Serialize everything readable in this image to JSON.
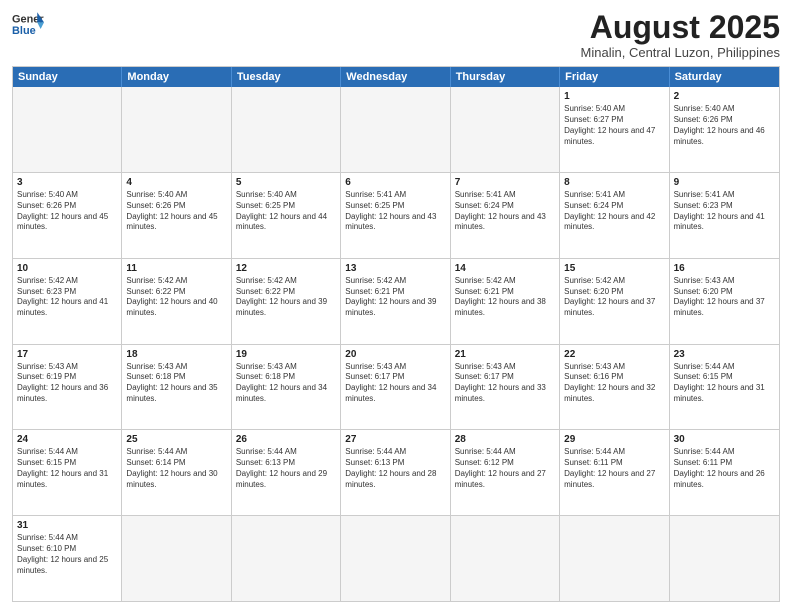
{
  "header": {
    "logo_general": "General",
    "logo_blue": "Blue",
    "month_year": "August 2025",
    "location": "Minalin, Central Luzon, Philippines"
  },
  "weekdays": [
    "Sunday",
    "Monday",
    "Tuesday",
    "Wednesday",
    "Thursday",
    "Friday",
    "Saturday"
  ],
  "rows": [
    [
      {
        "day": "",
        "info": ""
      },
      {
        "day": "",
        "info": ""
      },
      {
        "day": "",
        "info": ""
      },
      {
        "day": "",
        "info": ""
      },
      {
        "day": "",
        "info": ""
      },
      {
        "day": "1",
        "info": "Sunrise: 5:40 AM\nSunset: 6:27 PM\nDaylight: 12 hours and 47 minutes."
      },
      {
        "day": "2",
        "info": "Sunrise: 5:40 AM\nSunset: 6:26 PM\nDaylight: 12 hours and 46 minutes."
      }
    ],
    [
      {
        "day": "3",
        "info": "Sunrise: 5:40 AM\nSunset: 6:26 PM\nDaylight: 12 hours and 45 minutes."
      },
      {
        "day": "4",
        "info": "Sunrise: 5:40 AM\nSunset: 6:26 PM\nDaylight: 12 hours and 45 minutes."
      },
      {
        "day": "5",
        "info": "Sunrise: 5:40 AM\nSunset: 6:25 PM\nDaylight: 12 hours and 44 minutes."
      },
      {
        "day": "6",
        "info": "Sunrise: 5:41 AM\nSunset: 6:25 PM\nDaylight: 12 hours and 43 minutes."
      },
      {
        "day": "7",
        "info": "Sunrise: 5:41 AM\nSunset: 6:24 PM\nDaylight: 12 hours and 43 minutes."
      },
      {
        "day": "8",
        "info": "Sunrise: 5:41 AM\nSunset: 6:24 PM\nDaylight: 12 hours and 42 minutes."
      },
      {
        "day": "9",
        "info": "Sunrise: 5:41 AM\nSunset: 6:23 PM\nDaylight: 12 hours and 41 minutes."
      }
    ],
    [
      {
        "day": "10",
        "info": "Sunrise: 5:42 AM\nSunset: 6:23 PM\nDaylight: 12 hours and 41 minutes."
      },
      {
        "day": "11",
        "info": "Sunrise: 5:42 AM\nSunset: 6:22 PM\nDaylight: 12 hours and 40 minutes."
      },
      {
        "day": "12",
        "info": "Sunrise: 5:42 AM\nSunset: 6:22 PM\nDaylight: 12 hours and 39 minutes."
      },
      {
        "day": "13",
        "info": "Sunrise: 5:42 AM\nSunset: 6:21 PM\nDaylight: 12 hours and 39 minutes."
      },
      {
        "day": "14",
        "info": "Sunrise: 5:42 AM\nSunset: 6:21 PM\nDaylight: 12 hours and 38 minutes."
      },
      {
        "day": "15",
        "info": "Sunrise: 5:42 AM\nSunset: 6:20 PM\nDaylight: 12 hours and 37 minutes."
      },
      {
        "day": "16",
        "info": "Sunrise: 5:43 AM\nSunset: 6:20 PM\nDaylight: 12 hours and 37 minutes."
      }
    ],
    [
      {
        "day": "17",
        "info": "Sunrise: 5:43 AM\nSunset: 6:19 PM\nDaylight: 12 hours and 36 minutes."
      },
      {
        "day": "18",
        "info": "Sunrise: 5:43 AM\nSunset: 6:18 PM\nDaylight: 12 hours and 35 minutes."
      },
      {
        "day": "19",
        "info": "Sunrise: 5:43 AM\nSunset: 6:18 PM\nDaylight: 12 hours and 34 minutes."
      },
      {
        "day": "20",
        "info": "Sunrise: 5:43 AM\nSunset: 6:17 PM\nDaylight: 12 hours and 34 minutes."
      },
      {
        "day": "21",
        "info": "Sunrise: 5:43 AM\nSunset: 6:17 PM\nDaylight: 12 hours and 33 minutes."
      },
      {
        "day": "22",
        "info": "Sunrise: 5:43 AM\nSunset: 6:16 PM\nDaylight: 12 hours and 32 minutes."
      },
      {
        "day": "23",
        "info": "Sunrise: 5:44 AM\nSunset: 6:15 PM\nDaylight: 12 hours and 31 minutes."
      }
    ],
    [
      {
        "day": "24",
        "info": "Sunrise: 5:44 AM\nSunset: 6:15 PM\nDaylight: 12 hours and 31 minutes."
      },
      {
        "day": "25",
        "info": "Sunrise: 5:44 AM\nSunset: 6:14 PM\nDaylight: 12 hours and 30 minutes."
      },
      {
        "day": "26",
        "info": "Sunrise: 5:44 AM\nSunset: 6:13 PM\nDaylight: 12 hours and 29 minutes."
      },
      {
        "day": "27",
        "info": "Sunrise: 5:44 AM\nSunset: 6:13 PM\nDaylight: 12 hours and 28 minutes."
      },
      {
        "day": "28",
        "info": "Sunrise: 5:44 AM\nSunset: 6:12 PM\nDaylight: 12 hours and 27 minutes."
      },
      {
        "day": "29",
        "info": "Sunrise: 5:44 AM\nSunset: 6:11 PM\nDaylight: 12 hours and 27 minutes."
      },
      {
        "day": "30",
        "info": "Sunrise: 5:44 AM\nSunset: 6:11 PM\nDaylight: 12 hours and 26 minutes."
      }
    ],
    [
      {
        "day": "31",
        "info": "Sunrise: 5:44 AM\nSunset: 6:10 PM\nDaylight: 12 hours and 25 minutes."
      },
      {
        "day": "",
        "info": ""
      },
      {
        "day": "",
        "info": ""
      },
      {
        "day": "",
        "info": ""
      },
      {
        "day": "",
        "info": ""
      },
      {
        "day": "",
        "info": ""
      },
      {
        "day": "",
        "info": ""
      }
    ]
  ]
}
